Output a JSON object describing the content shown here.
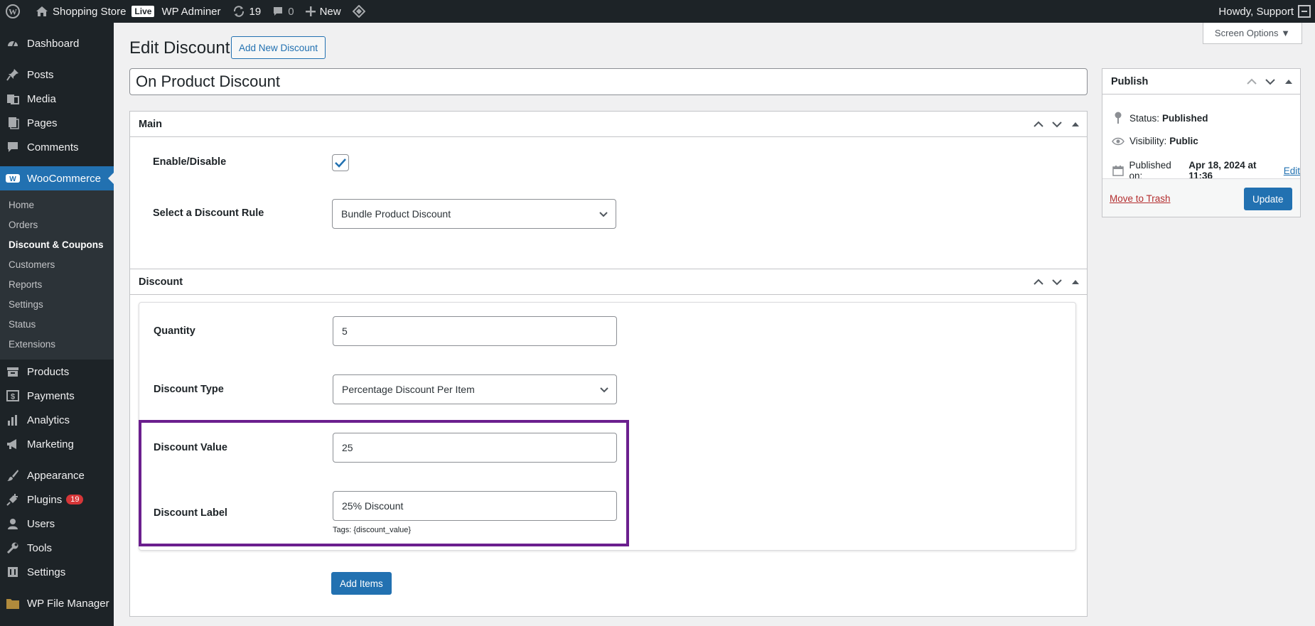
{
  "admin_bar": {
    "site_name": "Shopping Store",
    "live_badge": "Live",
    "admin_name": "WP Adminer",
    "updates_count": "19",
    "comments_count": "0",
    "new_label": "New",
    "howdy": "Howdy, Support"
  },
  "sidebar": {
    "dashboard": "Dashboard",
    "posts": "Posts",
    "media": "Media",
    "pages": "Pages",
    "comments": "Comments",
    "woocommerce": "WooCommerce",
    "woo_sub": [
      "Home",
      "Orders",
      "Discount & Coupons",
      "Customers",
      "Reports",
      "Settings",
      "Status",
      "Extensions"
    ],
    "products": "Products",
    "payments": "Payments",
    "analytics": "Analytics",
    "marketing": "Marketing",
    "appearance": "Appearance",
    "plugins": "Plugins",
    "plugins_count": "19",
    "users": "Users",
    "tools": "Tools",
    "settings": "Settings",
    "file_manager": "WP File Manager"
  },
  "header": {
    "screen_options": "Screen Options ▼",
    "title": "Edit Discount",
    "add_new": "Add New Discount",
    "post_title": "On Product Discount"
  },
  "main_box": {
    "title": "Main",
    "enable_label": "Enable/Disable",
    "enabled": true,
    "rule_label": "Select a Discount Rule",
    "rule_value": "Bundle Product Discount"
  },
  "discount_box": {
    "title": "Discount",
    "quantity_label": "Quantity",
    "quantity_value": "5",
    "type_label": "Discount Type",
    "type_value": "Percentage Discount Per Item",
    "value_label": "Discount Value",
    "value_value": "25",
    "dlabel_label": "Discount Label",
    "dlabel_value": "25% Discount",
    "tags_hint": "Tags: {discount_value}",
    "add_items": "Add Items",
    "highlight_color": "#6b1f8e"
  },
  "publish": {
    "title": "Publish",
    "status_label": "Status:",
    "status_value": "Published",
    "visibility_label": "Visibility:",
    "visibility_value": "Public",
    "published_label": "Published on:",
    "published_value": "Apr 18, 2024 at 11:36",
    "edit_link": "Edit",
    "trash": "Move to Trash",
    "update": "Update"
  },
  "colors": {
    "accent": "#2271b1",
    "admin_dark": "#1d2327",
    "badge_red": "#d63638"
  }
}
